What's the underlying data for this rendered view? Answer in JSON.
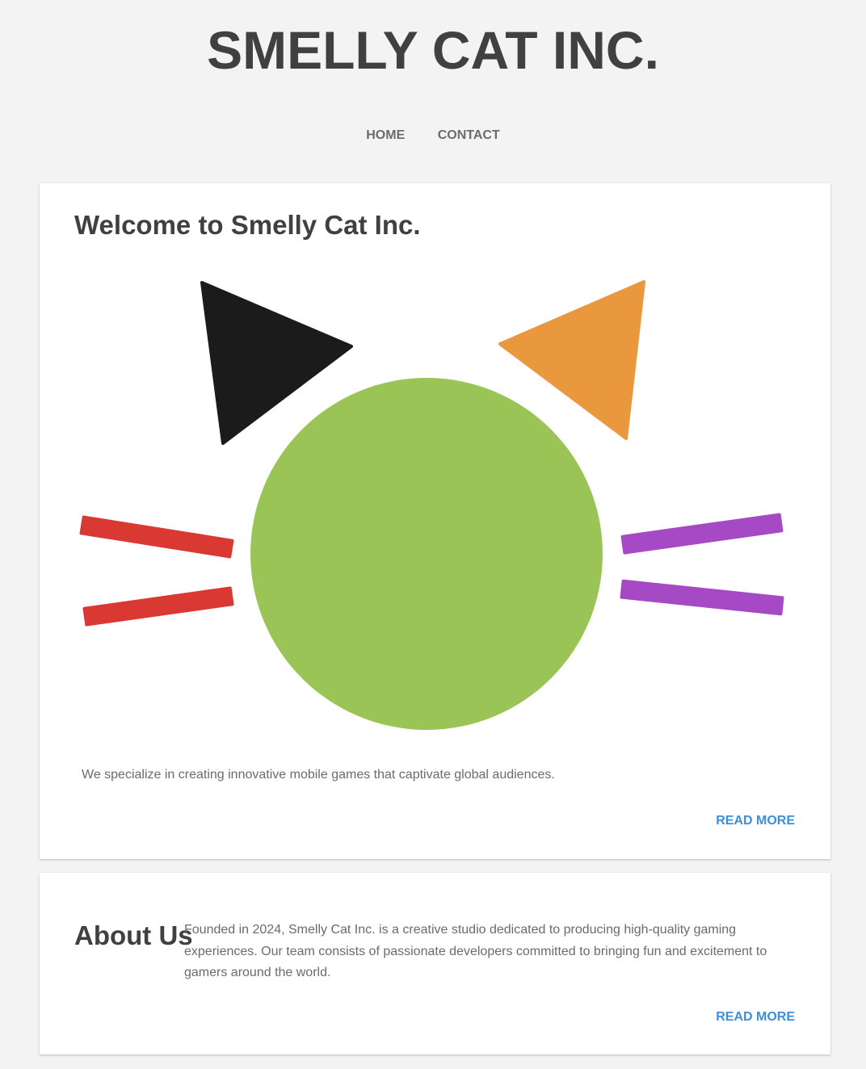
{
  "header": {
    "site_title": "SMELLY CAT INC."
  },
  "nav": {
    "items": [
      {
        "label": "HOME"
      },
      {
        "label": "CONTACT"
      }
    ]
  },
  "welcome": {
    "title": "Welcome to Smelly Cat Inc.",
    "text": "We specialize in creating innovative mobile games that captivate global audiences.",
    "read_more": "READ MORE"
  },
  "cat_logo": {
    "left_ear_color": "#1b1b1b",
    "right_ear_color": "#e9983e",
    "face_color": "#9ac556",
    "left_whiskers_color": "#da3832",
    "right_whiskers_color": "#a549c4"
  },
  "about": {
    "title": "About Us",
    "text": "Founded in 2024, Smelly Cat Inc. is a creative studio dedicated to producing high-quality gaming experiences. Our team consists of passionate developers committed to bringing fun and excitement to gamers around the world.",
    "read_more": "READ MORE"
  },
  "colors": {
    "background": "#f3f3f3",
    "card": "#ffffff",
    "heading": "#404040",
    "body_text": "#6b6b6b",
    "link": "#3d8fdb"
  }
}
